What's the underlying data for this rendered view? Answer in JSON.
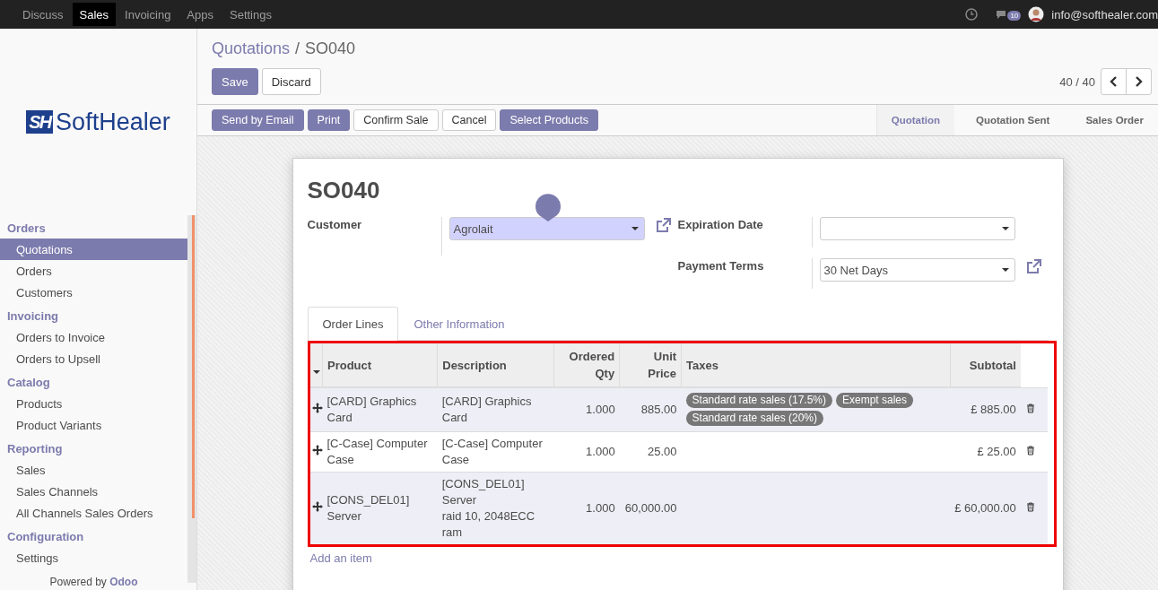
{
  "top_menu": [
    {
      "label": "Discuss",
      "selected": false
    },
    {
      "label": "Sales",
      "selected": true
    },
    {
      "label": "Invoicing",
      "selected": false
    },
    {
      "label": "Apps",
      "selected": false
    },
    {
      "label": "Settings",
      "selected": false
    }
  ],
  "systray": {
    "message_count": "10",
    "user": "info@softhealer.com"
  },
  "logo": {
    "mark": "SH",
    "text": "SoftHealer"
  },
  "sidebar": [
    {
      "title": "Orders",
      "items": [
        {
          "label": "Quotations",
          "selected": true
        },
        {
          "label": "Orders",
          "selected": false
        },
        {
          "label": "Customers",
          "selected": false
        }
      ]
    },
    {
      "title": "Invoicing",
      "items": [
        {
          "label": "Orders to Invoice",
          "selected": false
        },
        {
          "label": "Orders to Upsell",
          "selected": false
        }
      ]
    },
    {
      "title": "Catalog",
      "items": [
        {
          "label": "Products",
          "selected": false
        },
        {
          "label": "Product Variants",
          "selected": false
        }
      ]
    },
    {
      "title": "Reporting",
      "items": [
        {
          "label": "Sales",
          "selected": false
        },
        {
          "label": "Sales Channels",
          "selected": false
        },
        {
          "label": "All Channels Sales Orders",
          "selected": false
        }
      ]
    },
    {
      "title": "Configuration",
      "items": [
        {
          "label": "Settings",
          "selected": false
        }
      ]
    }
  ],
  "footer": "Powered by **Odoo**",
  "breadcrumb": [
    "Quotations",
    "SO040"
  ],
  "breadcrumb_separator": "/",
  "edit_buttons": [
    {
      "label": "Save",
      "kind": "primary"
    },
    {
      "label": "Discard",
      "kind": "secondary"
    }
  ],
  "pager": "40 / 40",
  "action_buttons": [
    {
      "label": "Send by Email",
      "kind": "primary"
    },
    {
      "label": "Print",
      "kind": "primary"
    },
    {
      "label": "Confirm Sale",
      "kind": "secondary"
    },
    {
      "label": "Cancel",
      "kind": "secondary"
    },
    {
      "label": "Select Products",
      "kind": "primary"
    }
  ],
  "stages": [
    {
      "label": "Quotation",
      "selected": true
    },
    {
      "label": "Quotation Sent",
      "selected": false
    },
    {
      "label": "Sales Order",
      "selected": false
    }
  ],
  "form": {
    "title": "SO040",
    "left_fields": [
      {
        "label": "Customer",
        "value": "Agrolait",
        "highlighted": true,
        "external_link": true
      }
    ],
    "right_fields": [
      {
        "label": "Expiration Date",
        "highlighted": false,
        "external_link": false
      },
      {
        "label": "Payment Terms",
        "value": "30 Net Days",
        "highlighted": false,
        "external_link": true
      }
    ]
  },
  "tabs": [
    {
      "label": "Order Lines",
      "selected": true
    },
    {
      "label": "Other Information",
      "selected": false
    }
  ],
  "table": {
    "columns": [
      "Product",
      "Description",
      "Ordered Qty",
      "Unit Price",
      "Taxes",
      "Subtotal"
    ],
    "rows": [
      {
        "product": "[CARD] Graphics Card",
        "description": "[CARD] Graphics Card",
        "qty": "1.000",
        "price": "885.00",
        "taxes": [
          "Standard rate sales (17.5%)",
          "Exempt sales",
          "Standard rate sales (20%)"
        ],
        "subtotal": "£ 885.00"
      },
      {
        "product": "[C-Case] Computer Case",
        "description": "[C-Case] Computer Case",
        "qty": "1.000",
        "price": "25.00",
        "taxes": [],
        "subtotal": "£ 25.00"
      },
      {
        "product": "[CONS_DEL01] Server",
        "description": "[CONS_DEL01] Server\nraid 10, 2048ECC ram",
        "qty": "1.000",
        "price": "60,000.00",
        "taxes": [],
        "subtotal": "£ 60,000.00"
      }
    ]
  },
  "add_item": "Add an item"
}
